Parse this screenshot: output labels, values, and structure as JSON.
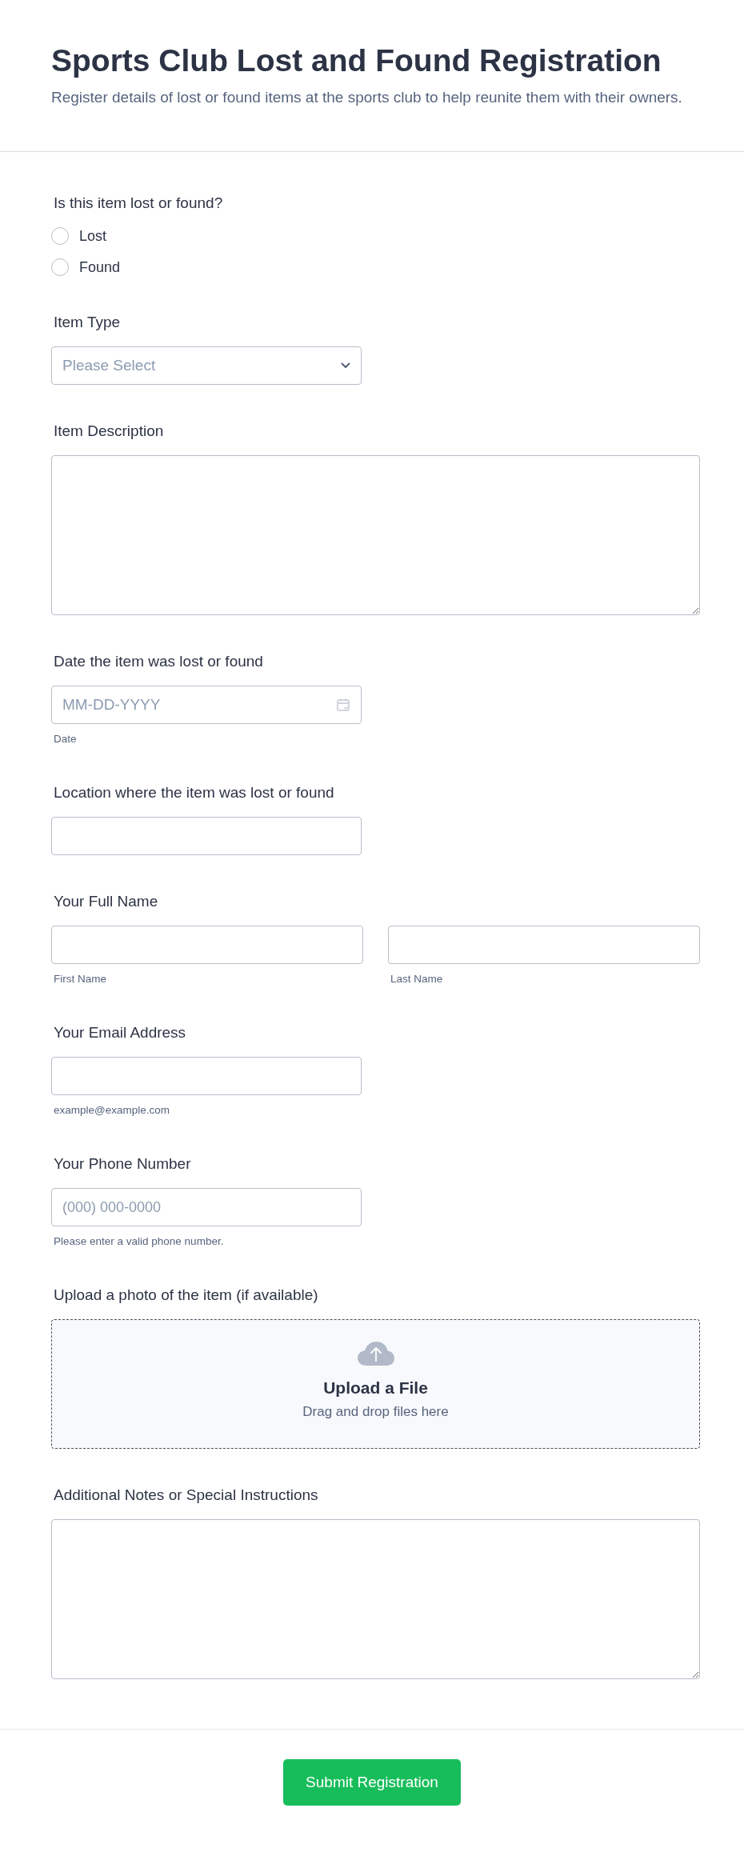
{
  "header": {
    "title": "Sports Club Lost and Found Registration",
    "description": "Register details of lost or found items at the sports club to help reunite them with their owners."
  },
  "fields": [
    {
      "kind": "radio",
      "label": "Is this item lost or found?",
      "options": [
        {
          "label": "Lost",
          "selected": false
        },
        {
          "label": "Found",
          "selected": false
        }
      ]
    },
    {
      "kind": "select",
      "label": "Item Type",
      "placeholder": "Please Select"
    },
    {
      "kind": "textarea",
      "label": "Item Description"
    },
    {
      "kind": "date",
      "label": "Date the item was lost or found",
      "placeholder": "MM-DD-YYYY",
      "sublabel": "Date"
    },
    {
      "kind": "text",
      "label": "Location where the item was lost or found"
    },
    {
      "kind": "name",
      "label": "Your Full Name",
      "parts": [
        {
          "sublabel": "First Name"
        },
        {
          "sublabel": "Last Name"
        }
      ]
    },
    {
      "kind": "text",
      "label": "Your Email Address",
      "sublabel": "example@example.com"
    },
    {
      "kind": "text",
      "label": "Your Phone Number",
      "placeholder": "(000) 000-0000",
      "sublabel": "Please enter a valid phone number."
    },
    {
      "kind": "upload",
      "label": "Upload a photo of the item (if available)",
      "title": "Upload a File",
      "hint": "Drag and drop files here"
    },
    {
      "kind": "textarea",
      "label": "Additional Notes or Special Instructions"
    }
  ],
  "submit": {
    "label": "Submit Registration"
  }
}
